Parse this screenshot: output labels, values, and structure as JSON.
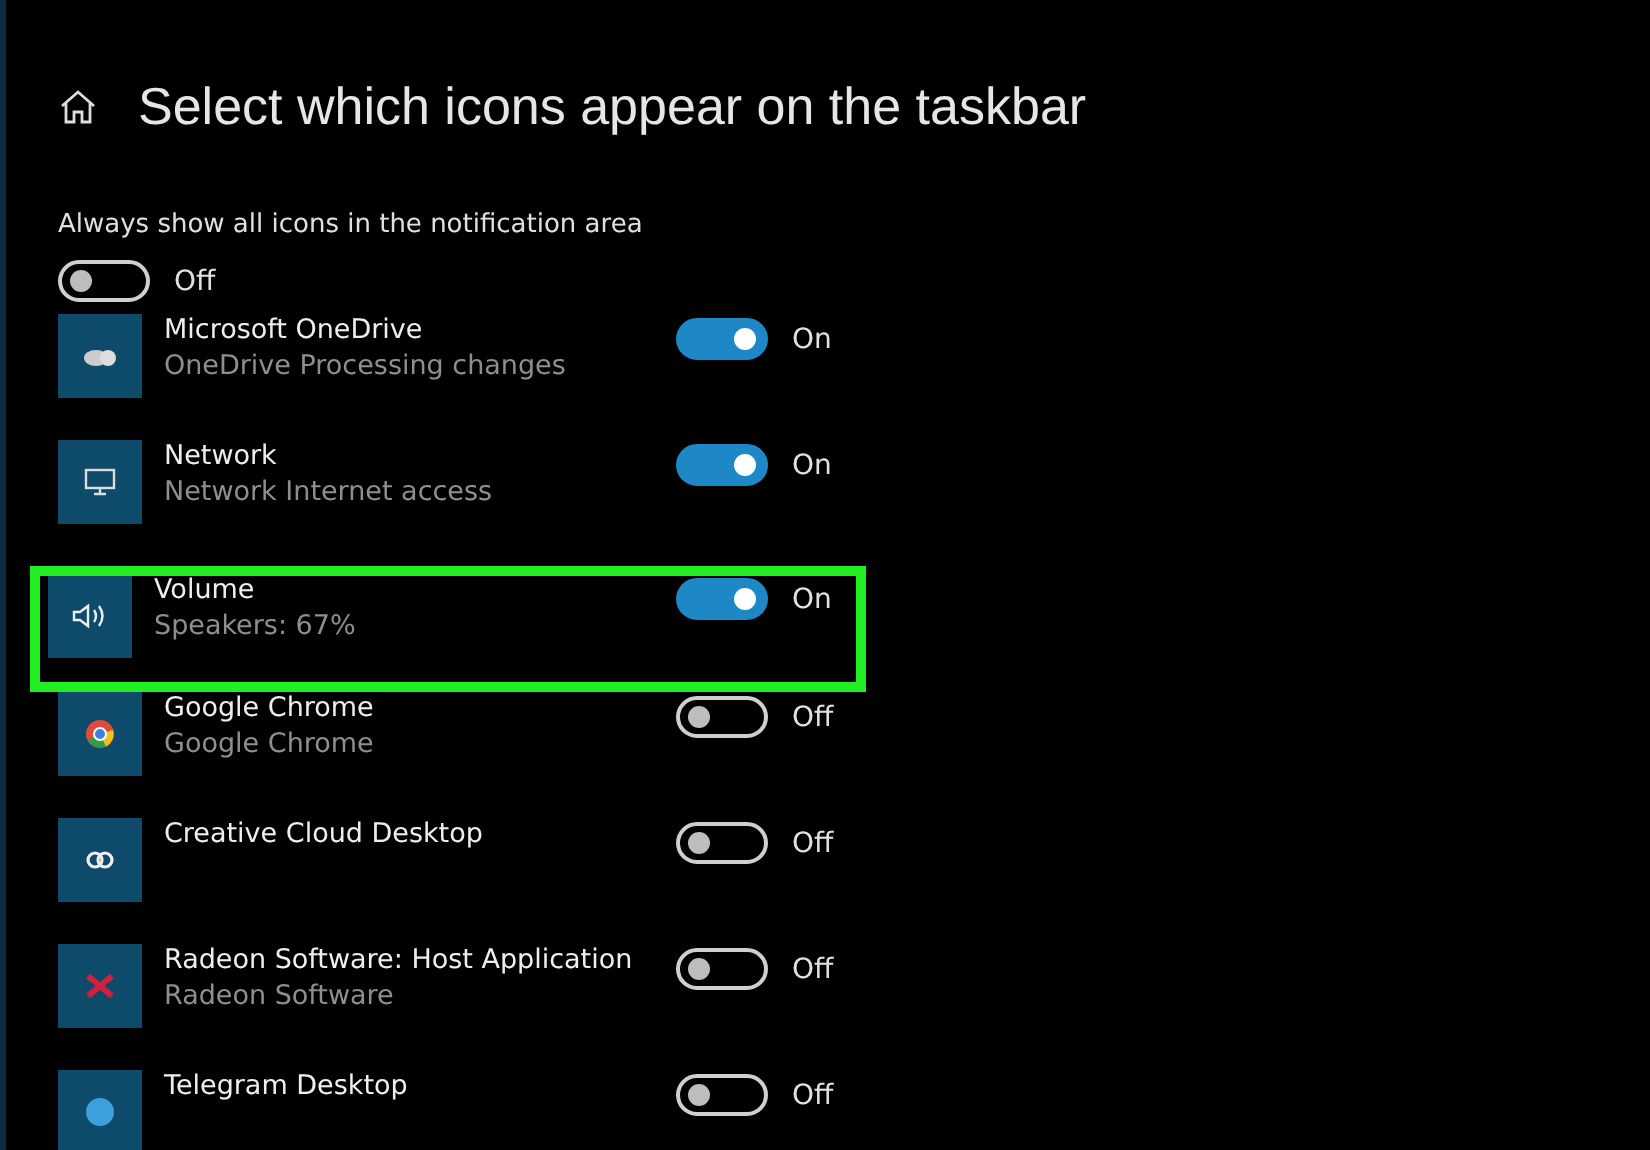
{
  "header": {
    "title": "Select which icons appear on the taskbar"
  },
  "always_show": {
    "label": "Always show all icons in the notification area",
    "on": false,
    "state_label": "Off"
  },
  "apps": [
    {
      "kind": "cloud",
      "name": "Microsoft OneDrive",
      "detail": "OneDrive Processing changes",
      "on": true,
      "state_label": "On",
      "highlighted": false
    },
    {
      "kind": "monitor",
      "name": "Network",
      "detail": "Network Internet access",
      "on": true,
      "state_label": "On",
      "highlighted": false
    },
    {
      "kind": "speaker",
      "name": "Volume",
      "detail": "Speakers: 67%",
      "on": true,
      "state_label": "On",
      "highlighted": true
    },
    {
      "kind": "browser",
      "name": "Google Chrome",
      "detail": "Google Chrome",
      "on": false,
      "state_label": "Off",
      "highlighted": false
    },
    {
      "kind": "links",
      "name": "Creative Cloud Desktop",
      "on": false,
      "state_label": "Off",
      "highlighted": false
    },
    {
      "kind": "cross",
      "name": "Radeon Software: Host Application",
      "detail": "Radeon Software",
      "on": false,
      "state_label": "Off",
      "highlighted": false
    },
    {
      "kind": "circle",
      "name": "Telegram Desktop",
      "on": false,
      "state_label": "Off",
      "highlighted": false
    }
  ]
}
